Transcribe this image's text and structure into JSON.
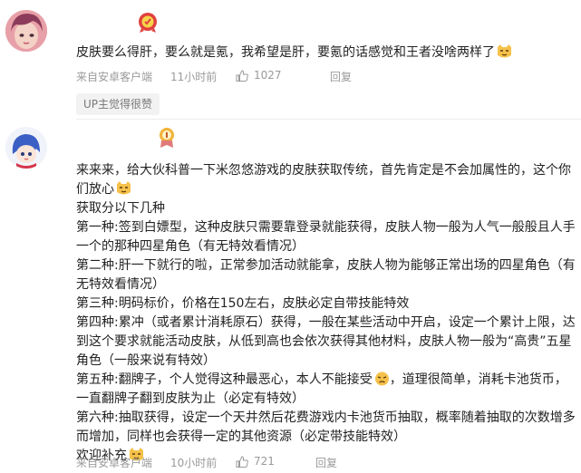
{
  "comments": [
    {
      "text": "皮肤要么得肝，要么就是氪，我希望是肝，要氪的话感觉和王者没啥两样了",
      "source": "来自安卓客户端",
      "time": "11小时前",
      "likes": "1027",
      "reply_label": "回复",
      "up_tag": "UP主觉得很赞"
    },
    {
      "lines": [
        "来来来，给大伙科普一下米忽悠游戏的皮肤获取传统，首先肯定是不会加属性的，这个你们放心",
        "获取分以下几种",
        "第一种:签到白嫖型，这种皮肤只需要靠登录就能获得，皮肤人物一般为人气一般般且人手一个的那种四星角色（有无特效看情况）",
        "第二种:肝一下就行的啦，正常参加活动就能拿，皮肤人物为能够正常出场的四星角色（有无特效看情况）",
        "第三种:明码标价，价格在150左右，皮肤必定自带技能特效",
        "第四种:累冲（或者累计消耗原石）获得，一般在某些活动中开启，设定一个累计上限，达到这个要求就能活动皮肤，从低到高也会依次获得其他材料，皮肤人物一般为“高贵”五星角色（一般来说有特效）",
        "第五种:翻牌子，个人觉得这种最恶心，本人不能接受",
        "，道理很简单，消耗卡池货币，一直翻牌子翻到皮肤为止（必定有特效）",
        "第六种:抽取获得，设定一个天井然后花费游戏内卡池货币抽取，概率随着抽取的次数增多而增加，同样也会获得一定的其他资源（必定带技能特效）",
        "欢迎补充"
      ],
      "source": "来自安卓客户端",
      "time": "10小时前",
      "likes": "721",
      "reply_label": "回复"
    }
  ],
  "colors": {
    "meta": "#9a9a9a",
    "text": "#222222",
    "tag_bg": "#f2f2f2"
  },
  "icons": [
    "avatar-girl",
    "level-badge-red",
    "avatar-anime-blue",
    "level-badge-gold",
    "smug-cat-emoji",
    "tired-emoji",
    "thumbs-up-icon"
  ]
}
